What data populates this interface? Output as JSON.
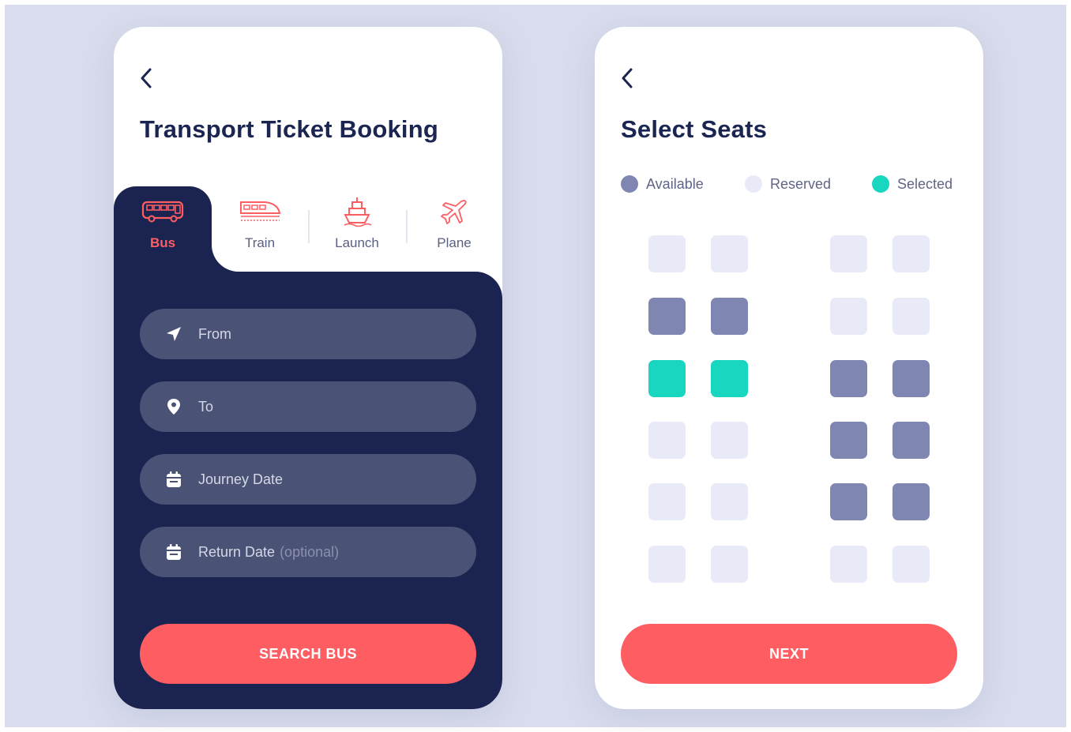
{
  "colors": {
    "background": "#d8dcec",
    "dark_navy": "#1b2450",
    "field_bg": "#4a5275",
    "accent_red": "#fe5d62",
    "seat_available": "#7f86b2",
    "seat_reserved": "#e8eaf8",
    "seat_selected": "#19d6c0"
  },
  "booking": {
    "back_icon": "chevron-left-icon",
    "title": "Transport Ticket Booking",
    "tabs": [
      {
        "label": "Bus",
        "icon": "bus-icon",
        "active": true
      },
      {
        "label": "Train",
        "icon": "train-icon",
        "active": false
      },
      {
        "label": "Launch",
        "icon": "ship-icon",
        "active": false
      },
      {
        "label": "Plane",
        "icon": "plane-icon",
        "active": false
      }
    ],
    "fields": {
      "from": {
        "placeholder": "From",
        "icon": "navigation-arrow-icon"
      },
      "to": {
        "placeholder": "To",
        "icon": "map-pin-icon"
      },
      "journey_date": {
        "placeholder": "Journey Date",
        "icon": "calendar-icon"
      },
      "return_date": {
        "placeholder": "Return Date",
        "optional_note": "(optional)",
        "icon": "calendar-icon"
      }
    },
    "search_button": "SEARCH BUS"
  },
  "seats": {
    "back_icon": "chevron-left-icon",
    "title": "Select Seats",
    "legend": {
      "available": "Available",
      "reserved": "Reserved",
      "selected": "Selected"
    },
    "layout": [
      [
        "reserved",
        "reserved",
        "reserved",
        "reserved"
      ],
      [
        "available",
        "available",
        "reserved",
        "reserved"
      ],
      [
        "selected",
        "selected",
        "available",
        "available"
      ],
      [
        "reserved",
        "reserved",
        "available",
        "available"
      ],
      [
        "reserved",
        "reserved",
        "available",
        "available"
      ],
      [
        "reserved",
        "reserved",
        "reserved",
        "reserved"
      ]
    ],
    "next_button": "NEXT"
  }
}
